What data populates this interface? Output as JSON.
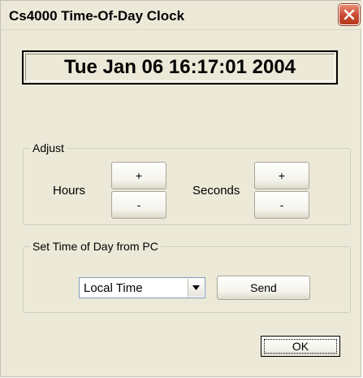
{
  "window": {
    "title": "Cs4000 Time-Of-Day Clock",
    "close_icon": "close-icon"
  },
  "clock": {
    "display": "Tue Jan 06 16:17:01 2004"
  },
  "adjust": {
    "group_label": "Adjust",
    "hours_label": "Hours",
    "hours_plus": "+",
    "hours_minus": "-",
    "seconds_label": "Seconds",
    "seconds_plus": "+",
    "seconds_minus": "-"
  },
  "set_time": {
    "group_label": "Set Time of Day from PC",
    "timezone_selected": "Local Time",
    "send_label": "Send"
  },
  "footer": {
    "ok_label": "OK"
  },
  "colors": {
    "window_bg": "#ece9d8",
    "close_red": "#c8492e",
    "focus_border": "#003c74"
  }
}
